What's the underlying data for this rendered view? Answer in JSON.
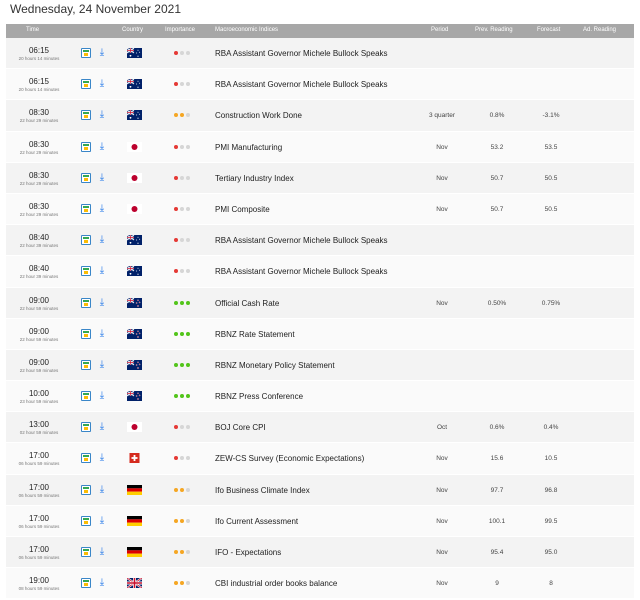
{
  "date_header": "Wednesday, 24 November 2021",
  "columns": {
    "time": "Time",
    "country": "Country",
    "importance": "Importance",
    "indices": "Macroeconomic Indices",
    "period": "Period",
    "prev": "Prev. Reading",
    "forecast": "Forecast",
    "adj": "Ad. Reading"
  },
  "colors": {
    "high": "#52c41a",
    "medium": "#f5a623",
    "low": "#e53935",
    "inactive": "#d6d6d6"
  },
  "rows": [
    {
      "time": "06:15",
      "ago": "20 hours 14 minutes",
      "flag": "australia",
      "importance": "low",
      "event": "RBA Assistant Governor Michele Bullock Speaks",
      "period": "",
      "prev": "",
      "forecast": ""
    },
    {
      "time": "06:15",
      "ago": "20 hours 14 minutes",
      "flag": "australia",
      "importance": "low",
      "event": "RBA Assistant Governor Michele Bullock Speaks",
      "period": "",
      "prev": "",
      "forecast": ""
    },
    {
      "time": "08:30",
      "ago": "22 hour 29 minutes",
      "flag": "australia",
      "importance": "medium",
      "event": "Construction Work Done",
      "period": "3 quarter",
      "prev": "0.8%",
      "forecast": "-3.1%"
    },
    {
      "time": "08:30",
      "ago": "22 hour 29 minutes",
      "flag": "japan",
      "importance": "low",
      "event": "PMI Manufacturing",
      "period": "Nov",
      "prev": "53.2",
      "forecast": "53.5"
    },
    {
      "time": "08:30",
      "ago": "22 hour 29 minutes",
      "flag": "japan",
      "importance": "low",
      "event": "Tertiary Industry Index",
      "period": "Nov",
      "prev": "50.7",
      "forecast": "50.5"
    },
    {
      "time": "08:30",
      "ago": "22 hour 29 minutes",
      "flag": "japan",
      "importance": "low",
      "event": "PMI Composite",
      "period": "Nov",
      "prev": "50.7",
      "forecast": "50.5"
    },
    {
      "time": "08:40",
      "ago": "22 hour 39 minutes",
      "flag": "australia",
      "importance": "low",
      "event": "RBA Assistant Governor Michele Bullock Speaks",
      "period": "",
      "prev": "",
      "forecast": ""
    },
    {
      "time": "08:40",
      "ago": "22 hour 39 minutes",
      "flag": "australia",
      "importance": "low",
      "event": "RBA Assistant Governor Michele Bullock Speaks",
      "period": "",
      "prev": "",
      "forecast": ""
    },
    {
      "time": "09:00",
      "ago": "22 hour 59 minutes",
      "flag": "newzealand",
      "importance": "high",
      "event": "Official Cash Rate",
      "period": "Nov",
      "prev": "0.50%",
      "forecast": "0.75%"
    },
    {
      "time": "09:00",
      "ago": "22 hour 59 minutes",
      "flag": "newzealand",
      "importance": "high",
      "event": "RBNZ Rate Statement",
      "period": "",
      "prev": "",
      "forecast": ""
    },
    {
      "time": "09:00",
      "ago": "22 hour 59 minutes",
      "flag": "newzealand",
      "importance": "high",
      "event": "RBNZ Monetary Policy Statement",
      "period": "",
      "prev": "",
      "forecast": ""
    },
    {
      "time": "10:00",
      "ago": "23 hour 59 minutes",
      "flag": "newzealand",
      "importance": "high",
      "event": "RBNZ Press Conference",
      "period": "",
      "prev": "",
      "forecast": ""
    },
    {
      "time": "13:00",
      "ago": "02 hour 59 minutes",
      "flag": "japan",
      "importance": "low",
      "event": "BOJ Core CPI",
      "period": "Oct",
      "prev": "0.6%",
      "forecast": "0.4%"
    },
    {
      "time": "17:00",
      "ago": "06 hours 59 minutes",
      "flag": "switzerland",
      "importance": "low",
      "event": "ZEW-CS Survey (Economic Expectations)",
      "period": "Nov",
      "prev": "15.6",
      "forecast": "10.5"
    },
    {
      "time": "17:00",
      "ago": "06 hours 59 minutes",
      "flag": "germany",
      "importance": "medium",
      "event": "Ifo Business Climate Index",
      "period": "Nov",
      "prev": "97.7",
      "forecast": "96.8"
    },
    {
      "time": "17:00",
      "ago": "06 hours 59 minutes",
      "flag": "germany",
      "importance": "medium",
      "event": "Ifo Current Assessment",
      "period": "Nov",
      "prev": "100.1",
      "forecast": "99.5"
    },
    {
      "time": "17:00",
      "ago": "06 hours 59 minutes",
      "flag": "germany",
      "importance": "medium",
      "event": "IFO - Expectations",
      "period": "Nov",
      "prev": "95.4",
      "forecast": "95.0"
    },
    {
      "time": "19:00",
      "ago": "08 hours 59 minutes",
      "flag": "uk",
      "importance": "medium",
      "event": "CBI industrial order books balance",
      "period": "Nov",
      "prev": "9",
      "forecast": "8"
    }
  ]
}
